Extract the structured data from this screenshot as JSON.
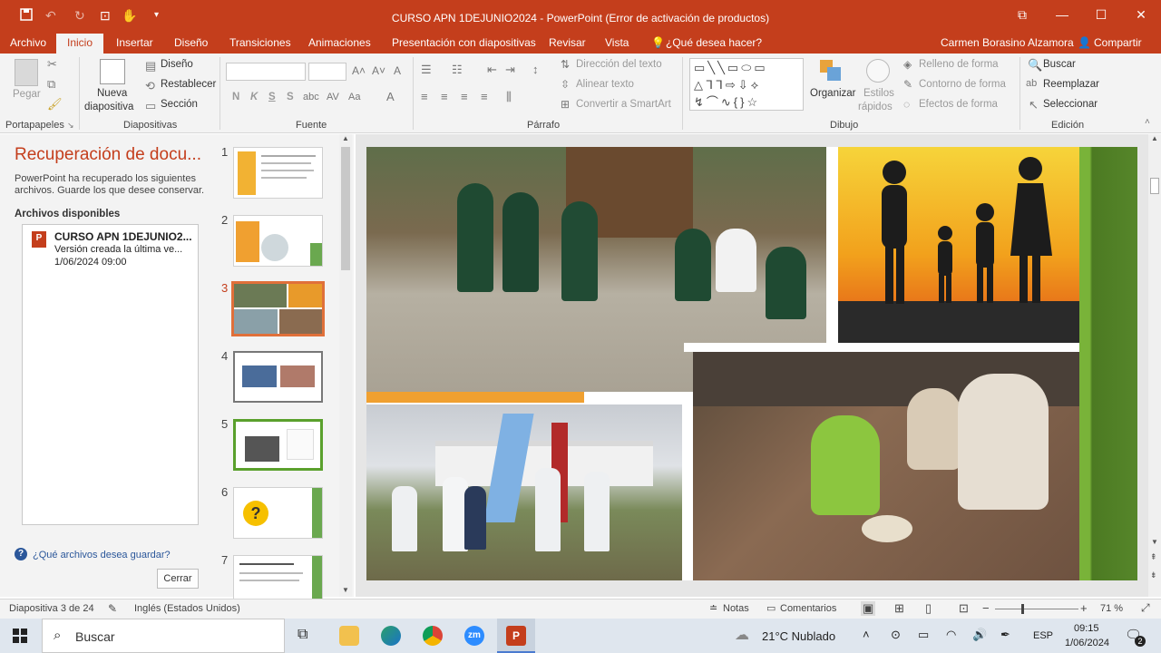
{
  "window": {
    "title": "CURSO APN 1DEJUNIO2024  -  PowerPoint (Error de activación de productos)"
  },
  "tabs": [
    "Archivo",
    "Inicio",
    "Insertar",
    "Diseño",
    "Transiciones",
    "Animaciones",
    "Presentación con diapositivas",
    "Revisar",
    "Vista",
    "¿Qué desea hacer?"
  ],
  "account": {
    "user": "Carmen Borasino Alzamora",
    "share": "Compartir"
  },
  "ribbon": {
    "clipboard": {
      "paste": "Pegar",
      "group": "Portapapeles"
    },
    "slides": {
      "new_slide_1": "Nueva",
      "new_slide_2": "diapositiva",
      "layout": "Diseño",
      "reset": "Restablecer",
      "section": "Sección",
      "group": "Diapositivas"
    },
    "font": {
      "bold": "N",
      "italic": "K",
      "underline": "S",
      "strike": "S",
      "group": "Fuente"
    },
    "paragraph": {
      "text_direction": "Dirección del texto",
      "align_text": "Alinear texto",
      "smartart": "Convertir a SmartArt",
      "group": "Párrafo"
    },
    "drawing": {
      "arrange": "Organizar",
      "styles_1": "Estilos",
      "styles_2": "rápidos",
      "fill": "Relleno de forma",
      "outline": "Contorno de forma",
      "effects": "Efectos de forma",
      "group": "Dibujo"
    },
    "editing": {
      "find": "Buscar",
      "replace": "Reemplazar",
      "select": "Seleccionar",
      "group": "Edición"
    }
  },
  "recovery": {
    "title": "Recuperación de docu...",
    "description": "PowerPoint ha recuperado los siguientes archivos. Guarde los que desee conservar.",
    "available_label": "Archivos disponibles",
    "file": {
      "name": "CURSO APN 1DEJUNIO2...",
      "version": "Versión creada la última ve...",
      "date": "1/06/2024 09:00"
    },
    "question": "¿Qué archivos desea guardar?",
    "close": "Cerrar"
  },
  "thumbnails": [
    "1",
    "2",
    "3",
    "4",
    "5",
    "6",
    "7"
  ],
  "selected_slide": 3,
  "statusbar": {
    "slide_info": "Diapositiva 3 de 24",
    "language": "Inglés (Estados Unidos)",
    "notes": "Notas",
    "comments": "Comentarios",
    "zoom": "71 %"
  },
  "taskbar": {
    "search": "Buscar",
    "weather": "21°C  Nublado",
    "lang": "ESP",
    "time": "09:15",
    "date": "1/06/2024",
    "notif_count": "2"
  },
  "colors": {
    "accent": "#c43e1c",
    "green_bar": "#5a8a2a"
  }
}
